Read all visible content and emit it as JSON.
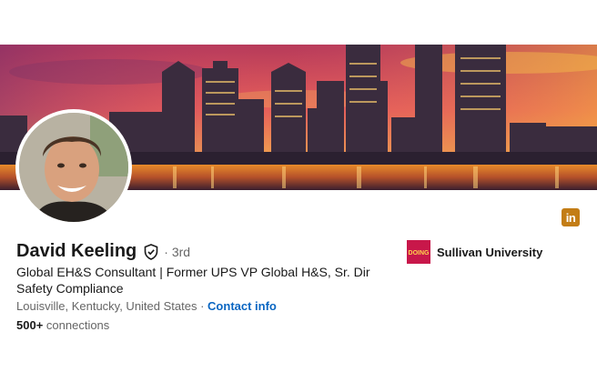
{
  "profile": {
    "name": "David Keeling",
    "degree": "3rd",
    "headline": "Global EH&S Consultant | Former UPS VP Global H&S, Sr. Dir Safety Compliance",
    "location": "Louisville, Kentucky, United States",
    "separator": " · ",
    "contact_label": "Contact info",
    "connections_count": "500+",
    "connections_label": " connections"
  },
  "education": {
    "name": "Sullivan University",
    "logo_text": "DOING"
  },
  "icons": {
    "banner": "city-skyline-banner",
    "avatar": "profile-photo",
    "verified": "verified-shield-icon",
    "linkedin": "linkedin-icon",
    "linkedin_text": "in",
    "school_logo": "school-logo-icon"
  },
  "colors": {
    "link": "#0a66c2",
    "linkedin_badge": "#c37d16",
    "school_logo": "#c8174a"
  }
}
